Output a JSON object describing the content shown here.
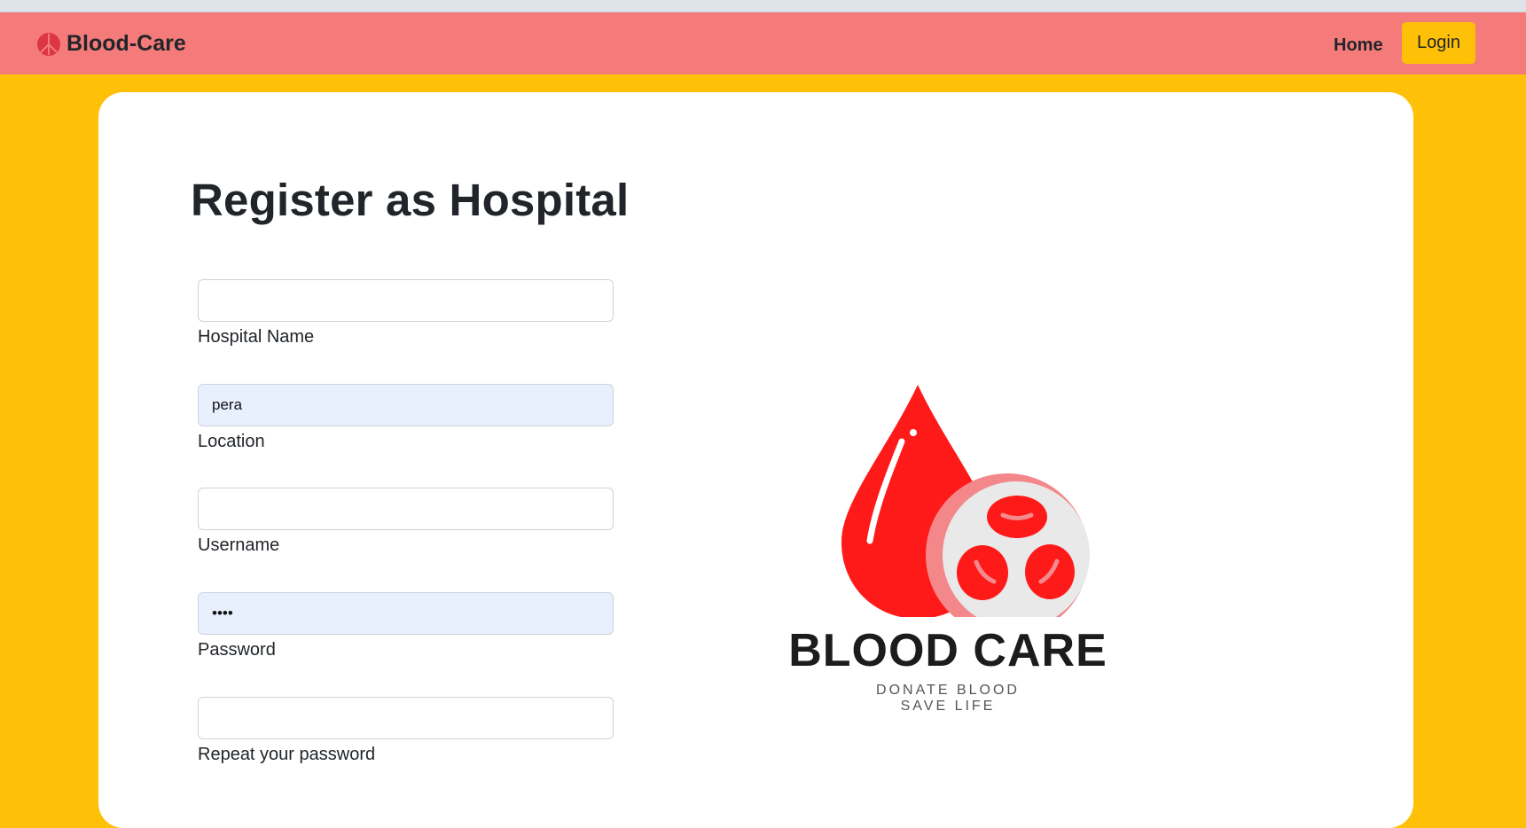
{
  "navbar": {
    "brand": "Blood-Care",
    "home_label": "Home",
    "login_label": "Login",
    "background": "#f47b7a",
    "login_color": "#ffc107"
  },
  "page": {
    "title": "Register as Hospital",
    "background": "#ffc107"
  },
  "form": {
    "fields": [
      {
        "label": "Hospital Name",
        "value": ""
      },
      {
        "label": "Location",
        "value": "pera"
      },
      {
        "label": "Username",
        "value": ""
      },
      {
        "label": "Password",
        "value": "••••"
      },
      {
        "label": "Repeat your password",
        "value": ""
      }
    ]
  },
  "logo": {
    "wordmark": "BLOOD CARE",
    "tagline_1": "DONATE BLOOD",
    "tagline_2": "SAVE LIFE",
    "drop_color": "#ff1a1a"
  }
}
